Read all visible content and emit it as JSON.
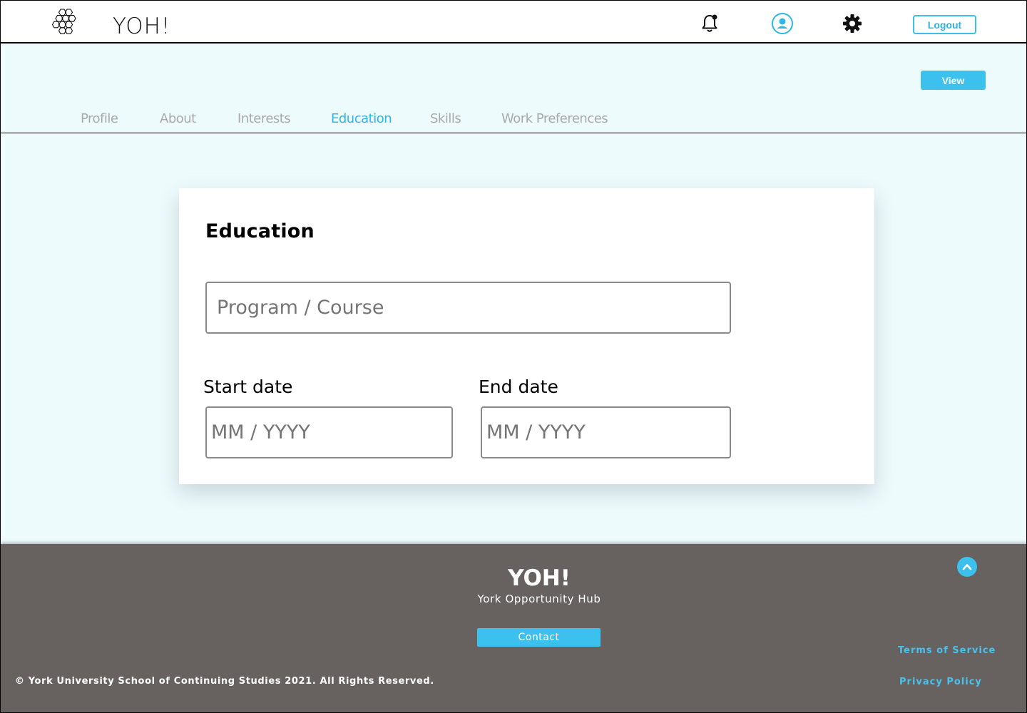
{
  "header": {
    "brand": "YOH!",
    "logout_label": "Logout",
    "icons": [
      "hexagon-logo-icon",
      "bell-icon",
      "user-icon",
      "gear-icon"
    ]
  },
  "subheader": {
    "view_label": "View",
    "tabs": [
      {
        "label": "Profile",
        "active": false
      },
      {
        "label": "About",
        "active": false
      },
      {
        "label": "Interests",
        "active": false
      },
      {
        "label": "Education",
        "active": true
      },
      {
        "label": "Skills",
        "active": false
      },
      {
        "label": "Work Preferences",
        "active": false
      }
    ]
  },
  "card": {
    "title": "Education",
    "program_placeholder": "Program / Course",
    "start_label": "Start date",
    "start_placeholder": "MM / YYYY",
    "end_label": "End date",
    "end_placeholder": "MM / YYYY"
  },
  "footer": {
    "brand": "YOH!",
    "subtitle": "York Opportunity Hub",
    "contact_label": "Contact",
    "terms_label": "Terms of Service",
    "privacy_label": "Privacy Policy",
    "copyright": "© York University School of Continuing Studies 2021. All Rights Reserved."
  },
  "colors": {
    "accent": "#3cc1ee",
    "page_bg": "#eefbfd",
    "footer_bg": "#67625f",
    "tab_inactive": "#a9a9a9",
    "tab_active": "#2eb6e6"
  }
}
